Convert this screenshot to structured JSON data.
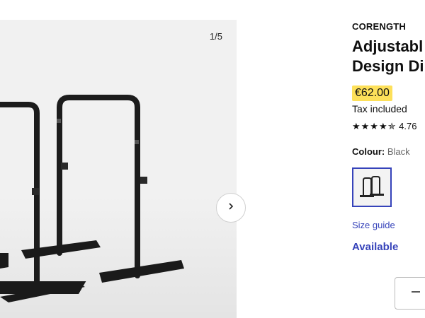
{
  "gallery": {
    "counter": "1/5",
    "image_subject": "product-photo-dip-bars",
    "next_icon": "chevron-right-icon"
  },
  "product": {
    "brand": "CORENGTH",
    "title_line1": "Adjustabl",
    "title_line2": "Design Di",
    "price": "€62.00",
    "price_highlight_color": "#fde05a",
    "tax_note": "Tax included",
    "stars": "★★★★✯",
    "rating_value": 4.76,
    "rating_text": "4.76",
    "colour_label": "Colour:",
    "colour_value": "Black",
    "swatch_icon": "dip-bars-thumbnail",
    "size_guide": "Size guide",
    "availability": "Available",
    "accent_color": "#3643ba",
    "quantity_icon": "minus-icon"
  }
}
